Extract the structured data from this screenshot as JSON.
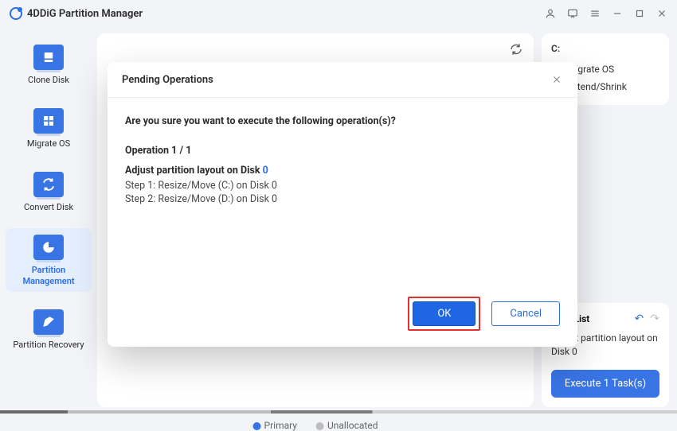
{
  "app": {
    "title": "4DDiG Partition Manager"
  },
  "sidebar": {
    "items": [
      {
        "label": "Clone Disk"
      },
      {
        "label": "Migrate OS"
      },
      {
        "label": "Convert Disk"
      },
      {
        "label": "Partition Management"
      },
      {
        "label": "Partition Recovery"
      }
    ]
  },
  "rightPanel": {
    "drive_label": "C:",
    "items": [
      {
        "label": "Migrate OS"
      },
      {
        "label": "Extend/Shrink"
      }
    ]
  },
  "taskList": {
    "title": "Task List",
    "line1": "Adjust partition layout on",
    "line2": "Disk 0",
    "button": "Execute 1 Task(s)"
  },
  "legend": {
    "primary": "Primary",
    "unallocated": "Unallocated"
  },
  "modal": {
    "title": "Pending Operations",
    "confirm": "Are you sure you want to execute the following operation(s)?",
    "op_counter": "Operation  1 / 1",
    "op_title_prefix": "Adjust partition layout on Disk ",
    "op_title_disk": "0",
    "steps": [
      "Step 1: Resize/Move (C:) on Disk 0",
      "Step 2: Resize/Move (D:) on Disk 0"
    ],
    "ok": "OK",
    "cancel": "Cancel"
  }
}
